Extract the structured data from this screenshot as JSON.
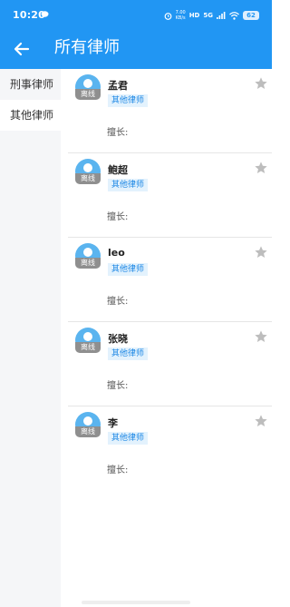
{
  "status_bar": {
    "time": "10:20",
    "speed_value": "7.00",
    "speed_unit": "KB/s",
    "network_1": "HD",
    "network_2": "5G",
    "battery": "62"
  },
  "app_bar": {
    "title": "所有律师",
    "background": "#2196F3"
  },
  "sidebar": {
    "items": [
      {
        "label": "刑事律师",
        "active": false
      },
      {
        "label": "其他律师",
        "active": true
      }
    ]
  },
  "lawyers": [
    {
      "name": "孟君",
      "status": "离线",
      "tag": "其他律师",
      "skill_label": "擅长:"
    },
    {
      "name": "鲍超",
      "status": "离线",
      "tag": "其他律师",
      "skill_label": "擅长:"
    },
    {
      "name": "leo",
      "status": "离线",
      "tag": "其他律师",
      "skill_label": "擅长:"
    },
    {
      "name": "张晓",
      "status": "离线",
      "tag": "其他律师",
      "skill_label": "擅长:"
    },
    {
      "name": "李",
      "status": "离线",
      "tag": "其他律师",
      "skill_label": "擅长:"
    }
  ]
}
